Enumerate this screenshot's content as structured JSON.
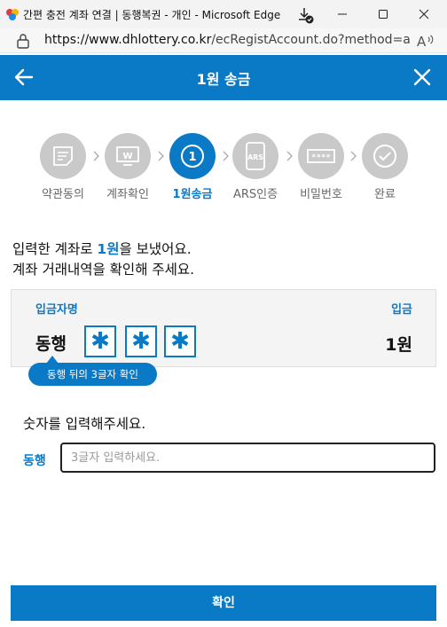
{
  "window": {
    "title": "간편 충전 계좌 연결 | 동행복권 - 개인 - Microsoft Edge",
    "url_host": "https://www.dhlottery.co.kr",
    "url_path": "/ecRegistAccount.do?method=accou…"
  },
  "header": {
    "title": "1원 송금"
  },
  "steps": [
    {
      "label": "약관동의",
      "icon": "document-icon",
      "state": "done"
    },
    {
      "label": "계좌확인",
      "icon": "monitor-w-icon",
      "state": "done"
    },
    {
      "label": "1원송금",
      "icon_text": "1",
      "state": "active"
    },
    {
      "label": "ARS인증",
      "icon_text": "ARS",
      "state": "pending"
    },
    {
      "label": "비밀번호",
      "icon_text": "****",
      "state": "pending"
    },
    {
      "label": "완료",
      "icon": "check-circle-icon",
      "state": "pending"
    }
  ],
  "message": {
    "line1_pre": "입력한 계좌로 ",
    "line1_highlight": "1원",
    "line1_post": "을 보냈어요.",
    "line2": "계좌 거래내역을 확인해 주세요."
  },
  "deposit_box": {
    "depositor_label": "입금자명",
    "amount_label": "입금",
    "depositor_name": "동행",
    "masked_chars": [
      "✱",
      "✱",
      "✱"
    ],
    "amount": "1원",
    "tip": "동행 뒤의 3글자 확인"
  },
  "input_section": {
    "prompt": "숫자를 입력해주세요.",
    "prefix_label": "동행",
    "placeholder": "3글자 입력하세요.",
    "value": ""
  },
  "confirm_label": "확인",
  "colors": {
    "accent": "#0a79c6",
    "step_inactive": "#c9c9c9"
  }
}
